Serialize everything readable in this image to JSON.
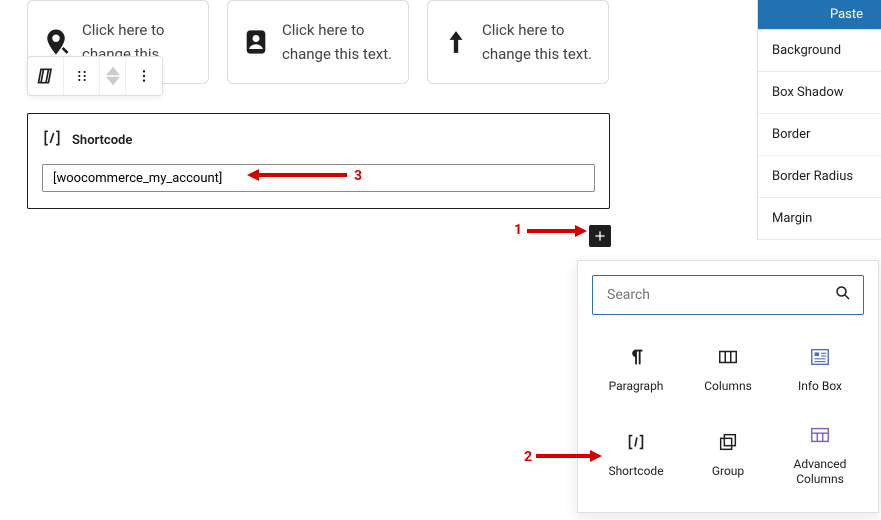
{
  "cards": [
    {
      "text": "Click here to change this"
    },
    {
      "text": "Click here to change this text."
    },
    {
      "text": "Click here to change this text."
    }
  ],
  "shortcode": {
    "title": "Shortcode",
    "value": "[woocommerce_my_account]"
  },
  "sidebar": {
    "paste": "Paste",
    "items": [
      "Background",
      "Box Shadow",
      "Border",
      "Border Radius",
      "Margin"
    ]
  },
  "inserter": {
    "search_placeholder": "Search",
    "blocks": [
      {
        "label": "Paragraph"
      },
      {
        "label": "Columns"
      },
      {
        "label": "Info Box"
      },
      {
        "label": "Shortcode"
      },
      {
        "label": "Group"
      },
      {
        "label": "Advanced Columns"
      }
    ]
  },
  "annotations": {
    "a1": "1",
    "a2": "2",
    "a3": "3"
  }
}
